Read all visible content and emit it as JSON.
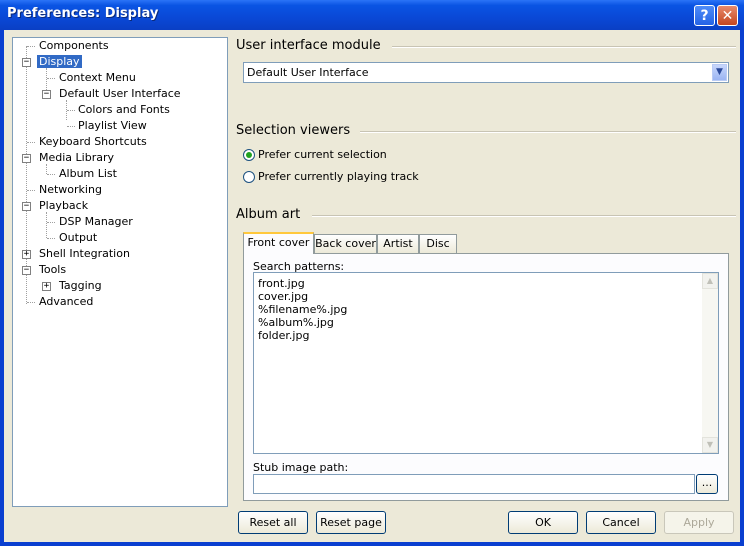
{
  "window": {
    "title": "Preferences: Display",
    "help_label": "?",
    "close_label": "✕"
  },
  "tree": [
    {
      "label": "Components",
      "expander": ""
    },
    {
      "label": "Display",
      "expander": "−"
    },
    {
      "label": "Context Menu",
      "expander": ""
    },
    {
      "label": "Default User Interface",
      "expander": "−"
    },
    {
      "label": "Colors and Fonts",
      "expander": ""
    },
    {
      "label": "Playlist View",
      "expander": ""
    },
    {
      "label": "Keyboard Shortcuts",
      "expander": ""
    },
    {
      "label": "Media Library",
      "expander": "−"
    },
    {
      "label": "Album List",
      "expander": ""
    },
    {
      "label": "Networking",
      "expander": ""
    },
    {
      "label": "Playback",
      "expander": "−"
    },
    {
      "label": "DSP Manager",
      "expander": ""
    },
    {
      "label": "Output",
      "expander": ""
    },
    {
      "label": "Shell Integration",
      "expander": "+"
    },
    {
      "label": "Tools",
      "expander": "−"
    },
    {
      "label": "Tagging",
      "expander": "+"
    },
    {
      "label": "Advanced",
      "expander": ""
    }
  ],
  "ui_module": {
    "heading": "User interface module",
    "selected": "Default User Interface"
  },
  "selection": {
    "heading": "Selection viewers",
    "options": [
      "Prefer current selection",
      "Prefer currently playing track"
    ]
  },
  "album_art": {
    "heading": "Album art",
    "tabs": [
      "Front cover",
      "Back cover",
      "Artist",
      "Disc"
    ],
    "patterns_label": "Search patterns:",
    "patterns": [
      "front.jpg",
      "cover.jpg",
      "%filename%.jpg",
      "%album%.jpg",
      "folder.jpg"
    ],
    "stub_label": "Stub image path:",
    "stub_value": "",
    "browse_label": "..."
  },
  "buttons": {
    "reset_all": "Reset all",
    "reset_page": "Reset page",
    "ok": "OK",
    "cancel": "Cancel",
    "apply": "Apply"
  }
}
